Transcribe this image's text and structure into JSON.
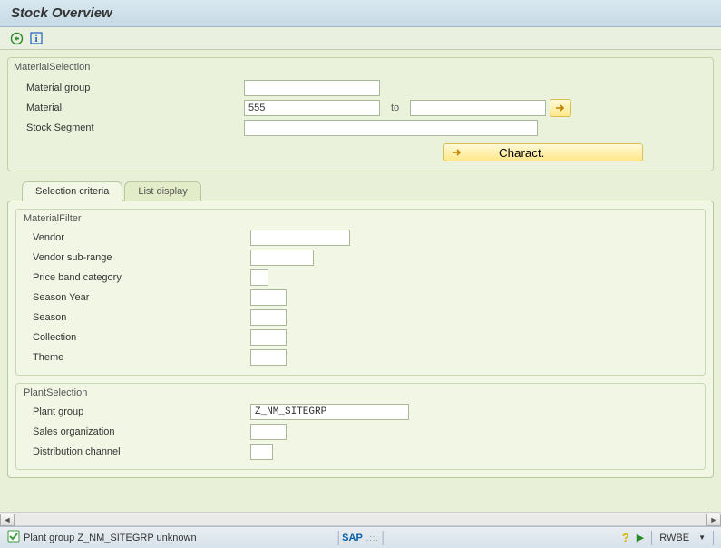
{
  "header": {
    "title": "Stock Overview"
  },
  "material_selection": {
    "title": "MaterialSelection",
    "material_group": {
      "label": "Material group",
      "value": ""
    },
    "material": {
      "label": "Material",
      "value": "555",
      "to_label": "to",
      "to_value": ""
    },
    "stock_segment": {
      "label": "Stock Segment",
      "value": ""
    },
    "charact_label": "Charact."
  },
  "tabs": {
    "selection_criteria": "Selection criteria",
    "list_display": "List display"
  },
  "material_filter": {
    "title": "MaterialFilter",
    "vendor": {
      "label": "Vendor",
      "value": ""
    },
    "vendor_sub_range": {
      "label": "Vendor sub-range",
      "value": ""
    },
    "price_band_category": {
      "label": "Price band category",
      "value": ""
    },
    "season_year": {
      "label": "Season Year",
      "value": ""
    },
    "season": {
      "label": "Season",
      "value": ""
    },
    "collection": {
      "label": "Collection",
      "value": ""
    },
    "theme": {
      "label": "Theme",
      "value": ""
    }
  },
  "plant_selection": {
    "title": "PlantSelection",
    "plant_group": {
      "label": "Plant group",
      "value": "Z_NM_SITEGRP"
    },
    "sales_organization": {
      "label": "Sales organization",
      "value": ""
    },
    "distribution_channel": {
      "label": "Distribution channel",
      "value": ""
    }
  },
  "statusbar": {
    "message": "Plant group Z_NM_SITEGRP unknown",
    "tcode": "RWBE"
  }
}
